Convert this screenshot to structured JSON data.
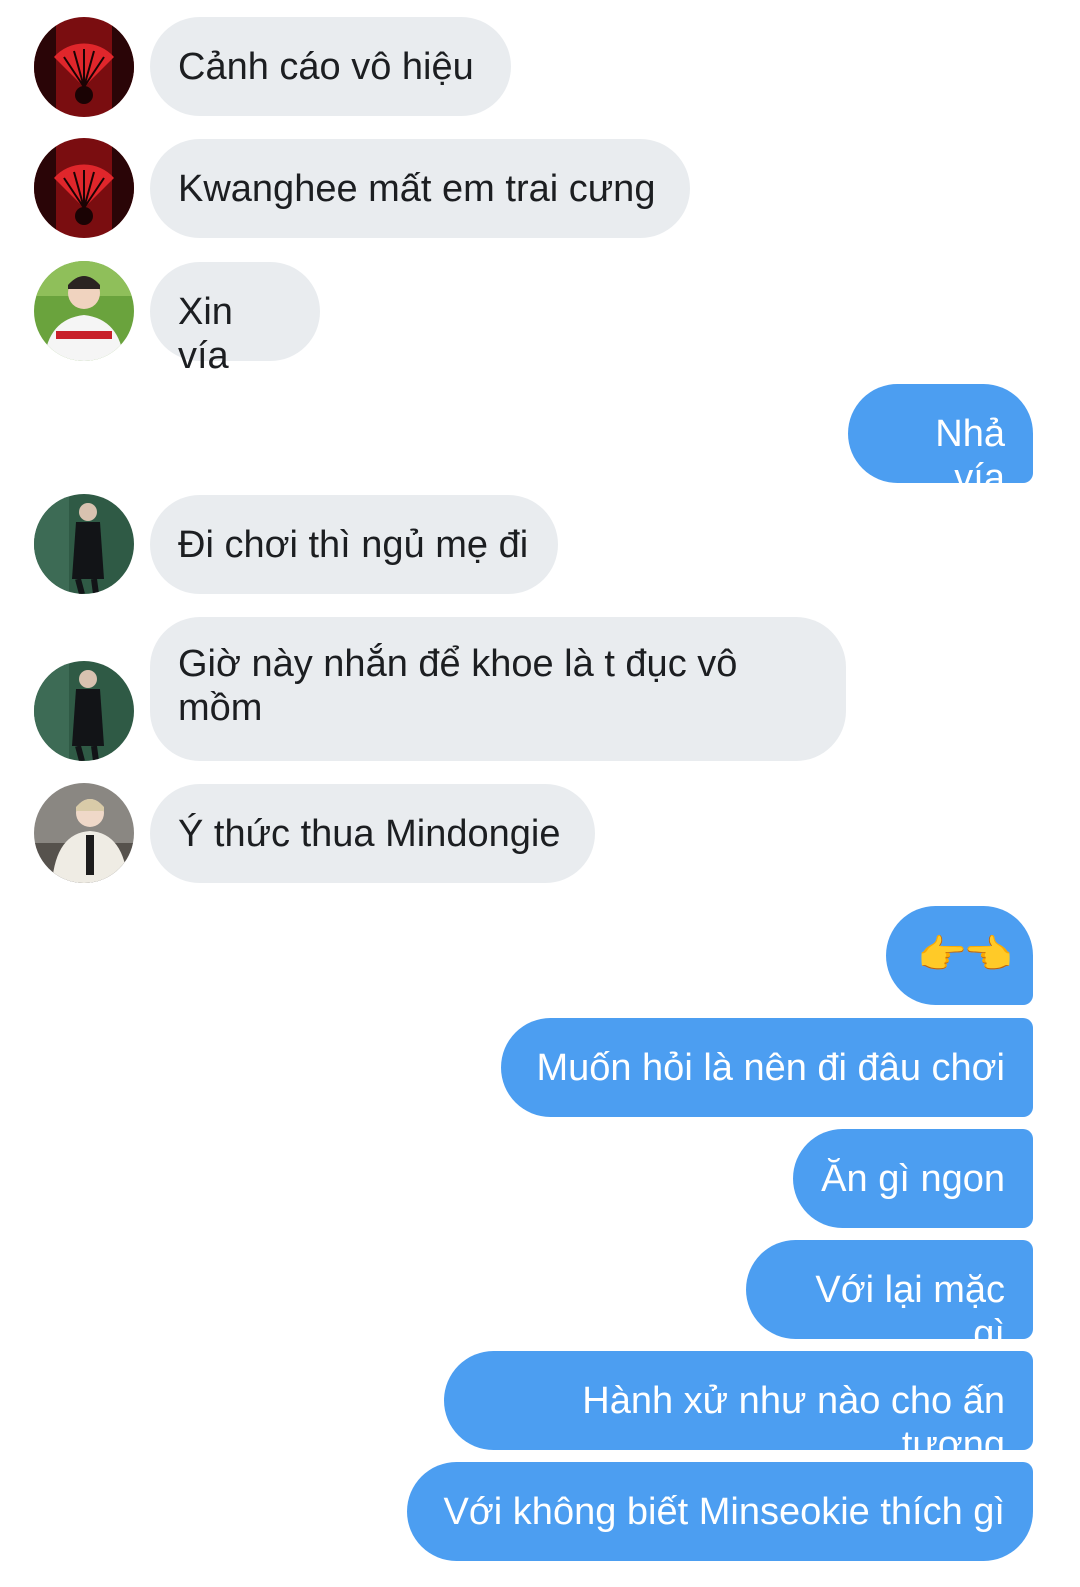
{
  "messages": {
    "m1": "Cảnh cáo vô hiệu",
    "m2": "Kwanghee mất em trai cưng",
    "m3": "Xin vía",
    "m4": "Nhả vía",
    "m5": "Đi chơi thì ngủ mẹ đi",
    "m6a": "Giờ này nhắn để khoe là t đục vô",
    "m6b": "mồm",
    "m7": "Ý thức thua Mindongie",
    "m8": "👉👈",
    "m9": "Muốn hỏi là nên đi đâu chơi",
    "m10": "Ăn gì ngon",
    "m11": "Với lại mặc gì",
    "m12": "Hành xử như nào cho ấn tượng",
    "m13": "Với không biết Minseokie thích gì"
  },
  "colors": {
    "incoming_bubble": "#e9ecef",
    "outgoing_bubble": "#4c9ef1",
    "incoming_text": "#1c1e21",
    "outgoing_text": "#ffffff"
  }
}
